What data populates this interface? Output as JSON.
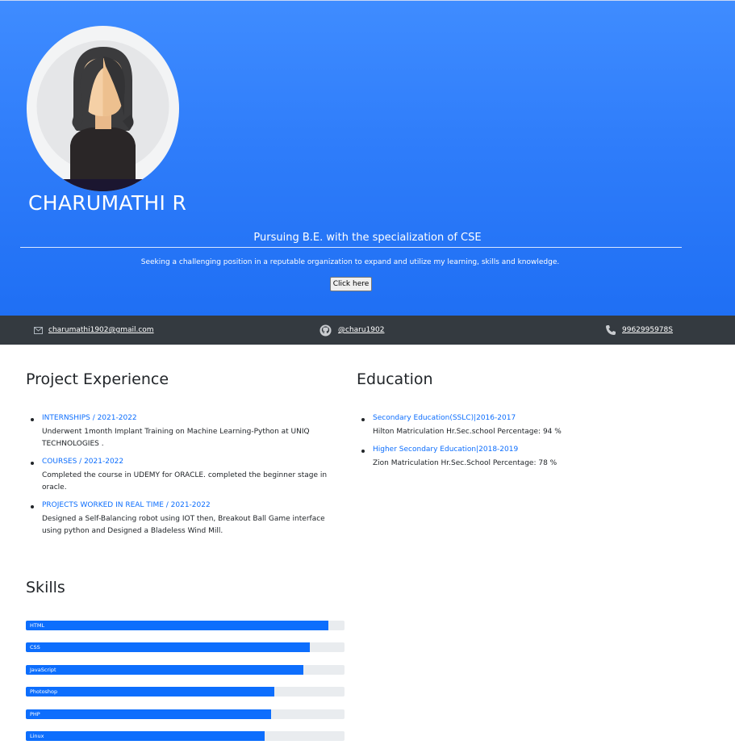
{
  "header": {
    "name": "CHARUMATHI R",
    "tagline": "Pursuing B.E. with the specialization of CSE",
    "objective": "Seeking a challenging position in a reputable organization to expand and utilize my learning, skills and knowledge.",
    "button_label": "Click here",
    "avatar_icon": "woman-avatar-icon"
  },
  "contacts": {
    "email": {
      "icon": "mail-icon",
      "text": "charumathi1902@gmail.com"
    },
    "github": {
      "icon": "github-icon",
      "text": "@charu1902"
    },
    "phone": {
      "icon": "phone-icon",
      "text": "9962995978S"
    }
  },
  "projects": {
    "title": "Project Experience",
    "items": [
      {
        "head": "INTERNSHIPS / 2021-2022",
        "body": "Underwent 1month Implant Training on Machine Learning-Python at UNIQ TECHNOLOGIES ."
      },
      {
        "head": "COURSES / 2021-2022",
        "body": "Completed the course in UDEMY for ORACLE. completed the beginner stage in oracle."
      },
      {
        "head": "PROJECTS WORKED IN REAL TIME / 2021-2022",
        "body": "Designed a Self-Balancing robot using IOT then, Breakout Ball Game interface using python and Designed a Bladeless Wind Mill."
      }
    ]
  },
  "education": {
    "title": "Education",
    "items": [
      {
        "head": "Secondary Education(SSLC)|2016-2017",
        "body": "Hilton Matriculation Hr.Sec.school Percentage: 94 %"
      },
      {
        "head": "Higher Secondary Education|2018-2019",
        "body": "Zion Matriculation Hr.Sec.School Percentage: 78 %"
      }
    ]
  },
  "skills": {
    "title": "Skills",
    "items": [
      {
        "name": "HTML",
        "level": 0.95
      },
      {
        "name": "CSS",
        "level": 0.89
      },
      {
        "name": "JavaScript",
        "level": 0.87
      },
      {
        "name": "Photoshop",
        "level": 0.78
      },
      {
        "name": "PHP",
        "level": 0.77
      },
      {
        "name": "Linux",
        "level": 0.75
      }
    ]
  },
  "colors": {
    "hero_top": "#3f8cff",
    "hero_bottom": "#1f6ff4",
    "contact_bar": "#343a40",
    "accent": "#0d6efd",
    "track": "#e9ecef"
  }
}
